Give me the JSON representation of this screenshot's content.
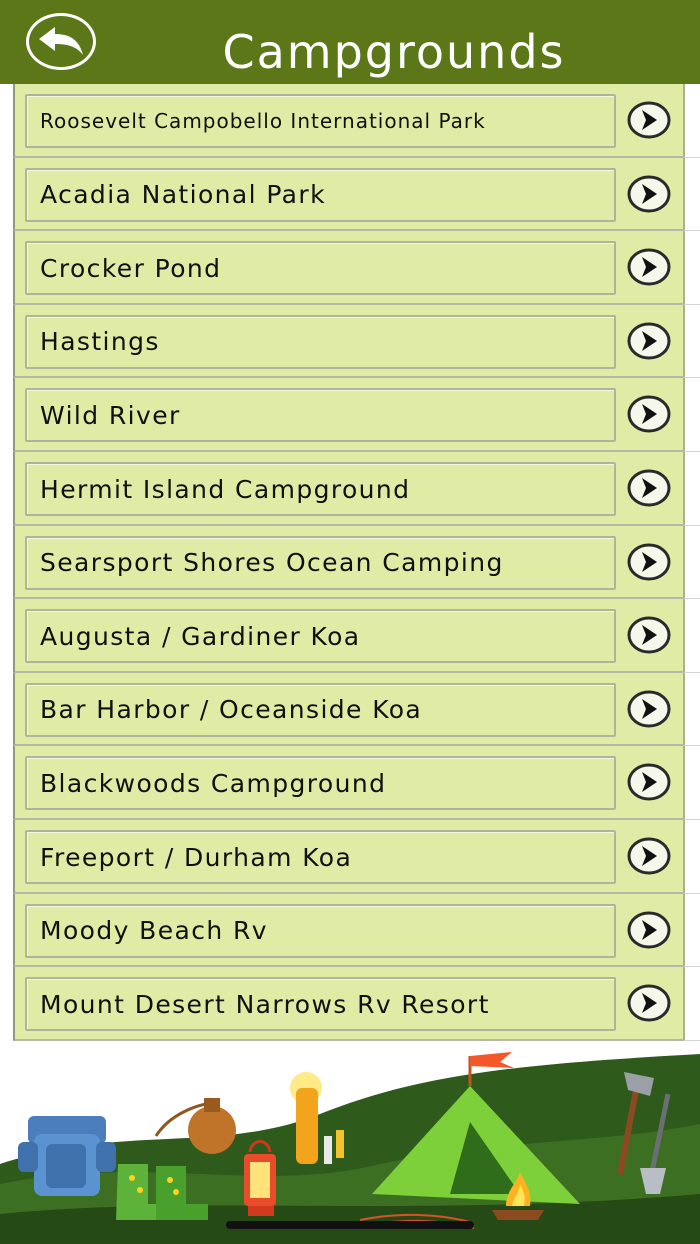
{
  "header": {
    "title": "Campgrounds",
    "back_icon": "back-arrow-icon"
  },
  "campgrounds": [
    {
      "label": "Roosevelt Campobello International Park"
    },
    {
      "label": "Acadia National Park"
    },
    {
      "label": "Crocker Pond"
    },
    {
      "label": "Hastings"
    },
    {
      "label": "Wild River"
    },
    {
      "label": "Hermit Island Campground"
    },
    {
      "label": "Searsport Shores Ocean Camping"
    },
    {
      "label": "Augusta / Gardiner Koa"
    },
    {
      "label": "Bar Harbor / Oceanside Koa"
    },
    {
      "label": "Blackwoods Campground"
    },
    {
      "label": "Freeport / Durham Koa"
    },
    {
      "label": "Moody Beach Rv"
    },
    {
      "label": "Mount Desert Narrows Rv Resort"
    }
  ],
  "row_icon": "chevron-right-circle-icon",
  "colors": {
    "header": "#5c7718",
    "row_background": "#e0eca6",
    "tent": "#6fbf2a",
    "hills": "#2e5a1c"
  }
}
